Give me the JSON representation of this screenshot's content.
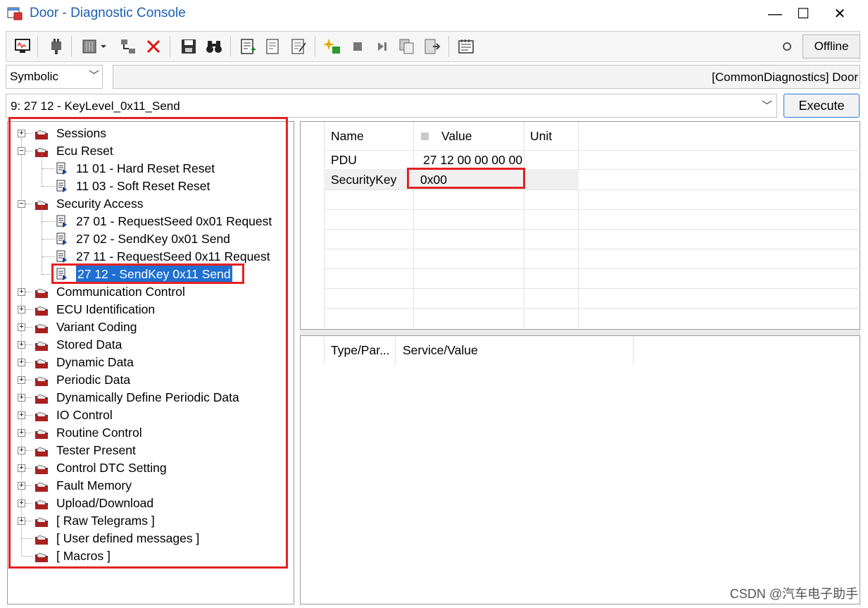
{
  "window": {
    "title": "Door - Diagnostic Console",
    "minimize": "—",
    "maximize": "☐",
    "close": "✕"
  },
  "toolbar": {
    "status": "Offline",
    "icons": [
      "monitor-icon",
      "plug-icon",
      "flash-dropdown-icon",
      "network-icon",
      "delete-icon",
      "save-icon",
      "binoculars-icon",
      "document-add-icon",
      "document-remove-icon",
      "document-edit-icon",
      "sparkle-icon",
      "stop-icon",
      "step-icon",
      "copy-icon",
      "export-icon",
      "notepad-icon"
    ]
  },
  "mode_select": {
    "value": "Symbolic"
  },
  "path_field": {
    "value": "[CommonDiagnostics] Door"
  },
  "service_select": {
    "value": "9: 27 12 - KeyLevel_0x11_Send"
  },
  "execute_button": "Execute",
  "tree": {
    "items": [
      {
        "label": "Sessions"
      },
      {
        "label": "Ecu Reset"
      },
      {
        "label": "11 01 - Hard Reset Reset"
      },
      {
        "label": "11 03 - Soft Reset Reset"
      },
      {
        "label": "Security Access"
      },
      {
        "label": "27 01 - RequestSeed 0x01 Request"
      },
      {
        "label": "27 02 - SendKey 0x01 Send"
      },
      {
        "label": "27 11 - RequestSeed 0x11 Request"
      },
      {
        "label": "27 12 - SendKey 0x11 Send"
      },
      {
        "label": "Communication Control"
      },
      {
        "label": "ECU Identification"
      },
      {
        "label": "Variant Coding"
      },
      {
        "label": "Stored Data"
      },
      {
        "label": "Dynamic Data"
      },
      {
        "label": "Periodic Data"
      },
      {
        "label": "Dynamically Define Periodic Data"
      },
      {
        "label": "IO Control"
      },
      {
        "label": "Routine Control"
      },
      {
        "label": "Tester Present"
      },
      {
        "label": "Control DTC Setting"
      },
      {
        "label": "Fault Memory"
      },
      {
        "label": "Upload/Download"
      },
      {
        "label": "[ Raw Telegrams ]"
      },
      {
        "label": "[ User defined messages ]"
      },
      {
        "label": "[ Macros ]"
      }
    ]
  },
  "params": {
    "headers": {
      "name": "Name",
      "value": "Value",
      "unit": "Unit"
    },
    "rows": [
      {
        "name": "PDU",
        "value": "27 12 00 00 00 00"
      },
      {
        "name": "SecurityKey",
        "value": "0x00"
      }
    ]
  },
  "log": {
    "headers": {
      "type": "Type/Par...",
      "service": "Service/Value"
    }
  },
  "watermark": "CSDN @汽车电子助手",
  "colors": {
    "accent": "#1e6fd1",
    "highlight": "#e32222"
  }
}
